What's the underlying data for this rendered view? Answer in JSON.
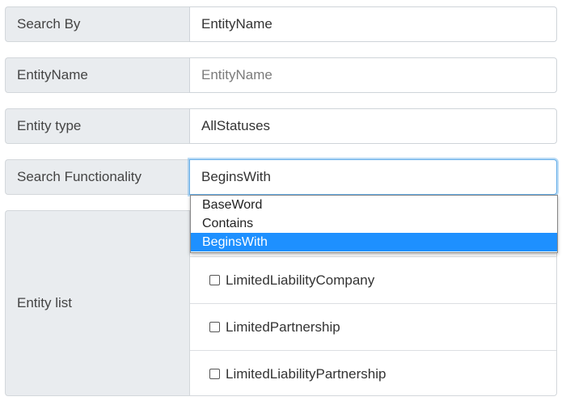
{
  "form": {
    "search_by": {
      "label": "Search By",
      "value": "EntityName"
    },
    "entity_name": {
      "label": "EntityName",
      "placeholder": "EntityName"
    },
    "entity_type": {
      "label": "Entity type",
      "value": "AllStatuses"
    },
    "search_functionality": {
      "label": "Search Functionality",
      "value": "BeginsWith",
      "options": [
        "BaseWord",
        "Contains",
        "BeginsWith"
      ],
      "selected_index": 2
    },
    "entity_list": {
      "label": "Entity list",
      "items": [
        "",
        "LimitedLiabilityCompany",
        "LimitedPartnership",
        "LimitedLiabilityPartnership"
      ]
    }
  },
  "colors": {
    "label_bg": "#e9ecef",
    "focus_ring": "#66afe9",
    "option_selected_bg": "#1e90ff"
  }
}
